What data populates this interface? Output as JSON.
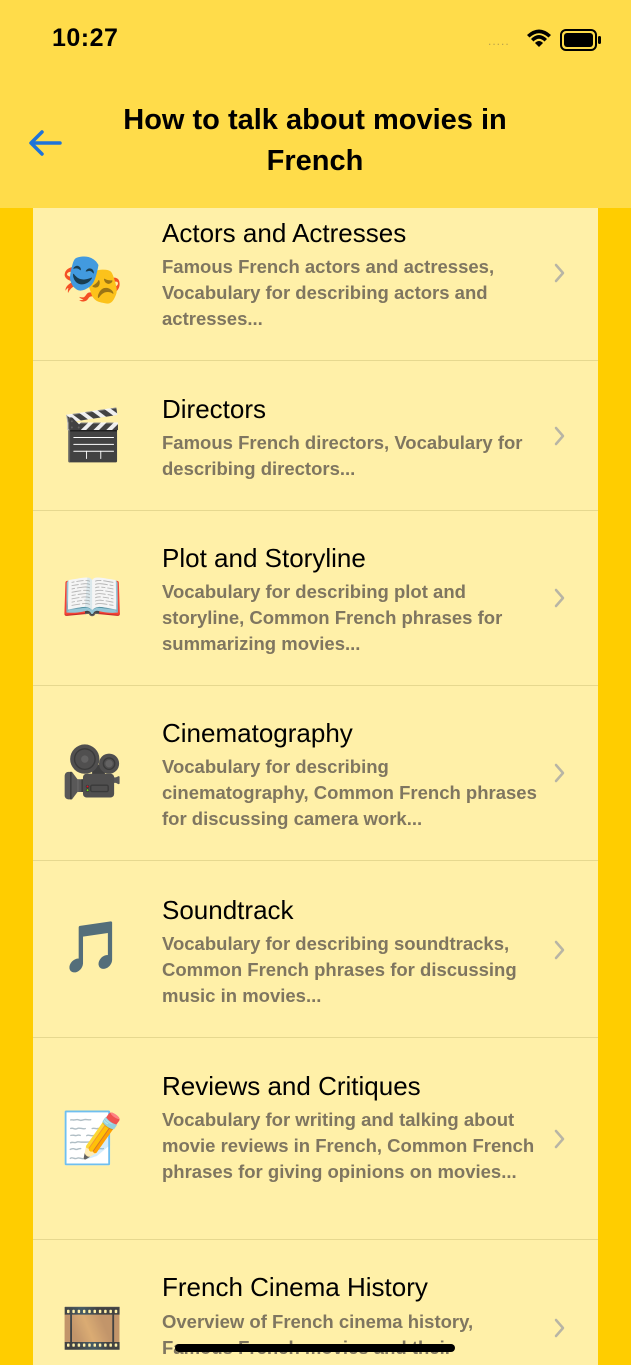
{
  "status_bar": {
    "time": "10:27",
    "dots": "....."
  },
  "nav": {
    "title": "How to talk about movies in French",
    "back_icon": "arrow-left-icon",
    "accent": "#1E73D9"
  },
  "colors": {
    "background": "#FFCD00",
    "header": "#FFDC4A",
    "card": "#FFF0A8",
    "description": "#7F7660"
  },
  "topics": [
    {
      "icon": "🎭",
      "icon_name": "performing-arts-icon",
      "title": "Actors and Actresses",
      "description": "Famous French actors and actresses, Vocabulary for describing actors and actresses..."
    },
    {
      "icon": "🎬",
      "icon_name": "clapper-board-icon",
      "title": "Directors",
      "description": "Famous French directors, Vocabulary for describing directors..."
    },
    {
      "icon": "📖",
      "icon_name": "open-book-icon",
      "title": "Plot and Storyline",
      "description": "Vocabulary for describing plot and storyline, Common French phrases for summarizing movies..."
    },
    {
      "icon": "🎥",
      "icon_name": "movie-camera-icon",
      "title": "Cinematography",
      "description": "Vocabulary for describing cinematography, Common French phrases for discussing camera work..."
    },
    {
      "icon": "🎵",
      "icon_name": "musical-note-icon",
      "title": "Soundtrack",
      "description": "Vocabulary for describing soundtracks, Common French phrases for discussing music in movies..."
    },
    {
      "icon": "📝",
      "icon_name": "memo-icon",
      "title": "Reviews and Critiques",
      "description": "Vocabulary for writing and talking about movie reviews in French, Common French phrases for giving opinions on movies..."
    },
    {
      "icon": "🎞️",
      "icon_name": "film-frames-icon",
      "title": "French Cinema History",
      "description": "Overview of French cinema history, Famous French movies and their"
    }
  ]
}
